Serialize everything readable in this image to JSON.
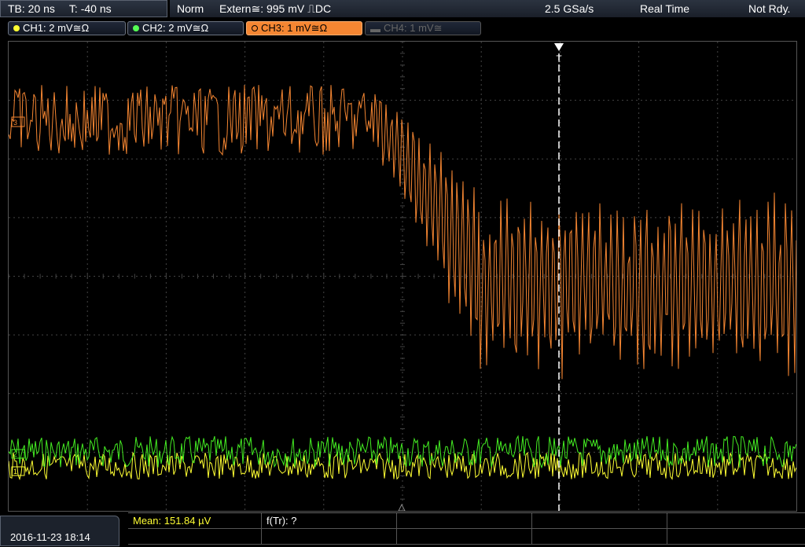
{
  "status": {
    "timebase": "TB: 20 ns",
    "trigger_time": "T: -40 ns",
    "mode": "Norm",
    "trigger_source": "Extern≅: 995 mV ⎍DC",
    "sample_rate": "2.5 GSa/s",
    "acquisition": "Real Time",
    "state": "Not Rdy."
  },
  "channels": [
    {
      "label": "CH1: 2 mV≅Ω",
      "color": "#ffff33",
      "state": "on"
    },
    {
      "label": "CH2: 2 mV≅Ω",
      "color": "#55ff55",
      "state": "on"
    },
    {
      "label": "CH3: 1 mV≅Ω",
      "color": "#f58632",
      "state": "active"
    },
    {
      "label": "CH4: 1 mV≅",
      "color": "#666666",
      "state": "off"
    }
  ],
  "trigger_marker": "T",
  "datetime": "2016-11-23 18:14",
  "measurements": {
    "mean": "Mean: 151.84 µV",
    "ftr": "f(Tr): ?"
  },
  "colors": {
    "ch1": "#ffff33",
    "ch2": "#44ee22",
    "ch3": "#f58632",
    "grid": "#444444"
  }
}
